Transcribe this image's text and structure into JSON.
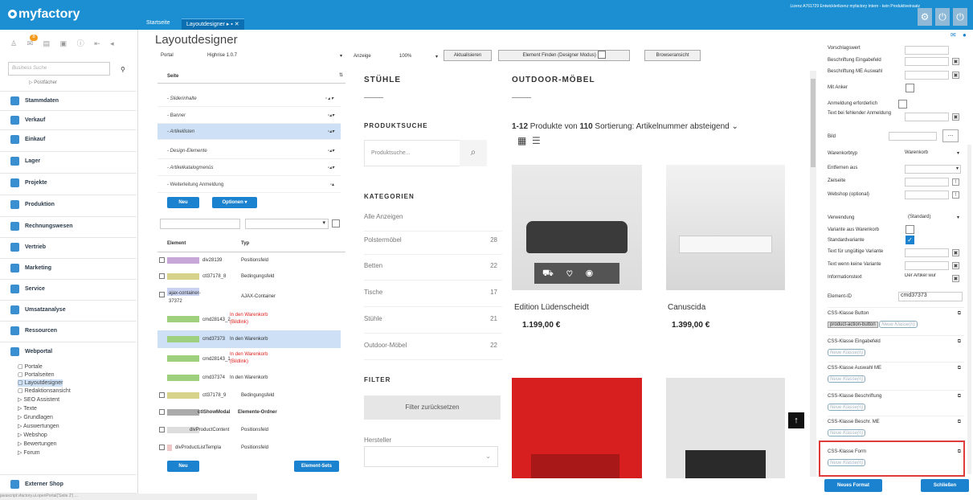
{
  "app": {
    "logo": "myfactory",
    "tabs": [
      {
        "label": "Startseite"
      },
      {
        "label": "Layoutdesigner"
      }
    ],
    "license": "Lizenz A761729 Entwicklerlizenz myfactory Intern - kein Produktiveinsatz",
    "badge_count": "8"
  },
  "sidebar": {
    "search_placeholder": "Business Suche",
    "truncated_item": "▷ Postfächer",
    "items": [
      {
        "label": "Stammdaten"
      },
      {
        "label": "Verkauf"
      },
      {
        "label": "Einkauf"
      },
      {
        "label": "Lager"
      },
      {
        "label": "Projekte"
      },
      {
        "label": "Produktion"
      },
      {
        "label": "Rechnungswesen"
      },
      {
        "label": "Vertrieb"
      },
      {
        "label": "Marketing"
      },
      {
        "label": "Service"
      },
      {
        "label": "Umsatzanalyse"
      },
      {
        "label": "Ressourcen"
      },
      {
        "label": "Webportal"
      }
    ],
    "sub": [
      "Portale",
      "Portalseiten",
      "Layoutdesigner",
      "Redaktionsansicht",
      "▷ SEO Assistent",
      "▷ Texte",
      "▷ Grundlagen",
      "▷ Auswertungen",
      "▷ Webshop",
      "▷ Bewertungen",
      "▷ Forum"
    ],
    "external": "Externer Shop"
  },
  "designer": {
    "title": "Layoutdesigner",
    "portal_label": "Portal",
    "portal_value": "Highrise 1.0.7",
    "view_label": "Anzeige",
    "zoom": "100%",
    "refresh": "Aktualisieren",
    "find": "Element Finden (Designer Modus)",
    "browser": "Browseransicht",
    "page_col": "Seite",
    "pages": [
      "- Sliderinhalte",
      "- Banner",
      "- Artikellisten",
      "- Design-Elemente",
      "- Artikelkatalogmenüs",
      "- Weiterleitung Anmeldung"
    ],
    "new_btn": "Neu",
    "options_btn": "Optionen ▾",
    "el_col": "Element",
    "type_col": "Typ",
    "elements": [
      {
        "el": "div28139",
        "type": "Positionsfeld"
      },
      {
        "el": "ctl37178_8",
        "type": "Bedingungsfeld"
      },
      {
        "el": "ajax-container-37372",
        "type": "AJAX-Container"
      },
      {
        "el": "cmd28143_2",
        "type": "In den Warenkorb (Bildlink)"
      },
      {
        "el": "cmd37373",
        "type": "In den Warenkorb"
      },
      {
        "el": "cmd28143_1",
        "type": "In den Warenkorb (Bildlink)"
      },
      {
        "el": "cmd37374",
        "type": "In den Warenkorb"
      },
      {
        "el": "ctl37178_9",
        "type": "Bedingungsfeld"
      },
      {
        "el": "ctlShowModal",
        "type": "Elemente-Ordner"
      },
      {
        "el": "divProductContent",
        "type": "Positionsfeld"
      },
      {
        "el": "divProductListTempla",
        "type": "Positionsfeld"
      }
    ],
    "new_btn2": "Neu",
    "sets_btn": "Element-Sets"
  },
  "preview": {
    "stuehle": "STÜHLE",
    "outdoor": "OUTDOOR-MÖBEL",
    "search_title": "PRODUKTSUCHE",
    "search_ph": "Produktsuche...",
    "cat_title": "KATEGORIEN",
    "cats": [
      {
        "name": "Alle Anzeigen",
        "n": ""
      },
      {
        "name": "Polstermöbel",
        "n": "28"
      },
      {
        "name": "Betten",
        "n": "22"
      },
      {
        "name": "Tische",
        "n": "17"
      },
      {
        "name": "Stühle",
        "n": "21"
      },
      {
        "name": "Outdoor-Möbel",
        "n": "22"
      }
    ],
    "filter_title": "FILTER",
    "filter_reset": "Filter zurücksetzen",
    "manufacturer": "Hersteller",
    "count_prefix": "1-12",
    "count_mid": " Produkte von ",
    "count_total": "110",
    "sort": "Sortierung: Artikelnummer absteigend",
    "products": [
      {
        "name": "Edition Lüdenscheidt",
        "price": "1.199,00",
        "cur": "€"
      },
      {
        "name": "Canuscida",
        "price": "1.399,00",
        "cur": "€"
      }
    ]
  },
  "props": {
    "r1": "Vorschlagswert",
    "r2": "Beschriftung Eingabefeld",
    "r3": "Beschriftung ME Auswahl",
    "r4": "Mit Anker",
    "r5": "Anmeldung erforderlich",
    "r6": "Text bei fehlender Anmeldung",
    "r7": "Bild",
    "r8": "Warenkorbtyp",
    "r8v": "Warenkorb",
    "r9": "Entfernen aus",
    "r10": "Zielseite",
    "r11": "Webshop (optional)",
    "r12": "Verwendung",
    "r12v": "(Standard)",
    "r13": "Variante aus Warenkorb",
    "r14": "Standardvariante",
    "r15": "Text für ungültige Variante",
    "r16": "Text wenn keine Variante",
    "r17": "Informationstext",
    "r17v": "Der Artikel wur",
    "r18": "Element-ID",
    "r18v": "cmd37373",
    "css": [
      {
        "label": "CSS-Klasse Button",
        "val": "product-action-button"
      },
      {
        "label": "CSS-Klasse Eingabefeld"
      },
      {
        "label": "CSS-Klasse Auswahl ME"
      },
      {
        "label": "CSS-Klasse Beschriftung"
      },
      {
        "label": "CSS-Klasse Beschr. ME"
      },
      {
        "label": "CSS-Klasse Form"
      }
    ],
    "new_class": "Neue Klasse(n)",
    "new_format": "Neues Format",
    "close": "Schließen"
  },
  "statusbar": "javascript:vfactory.ui.openPortal('Seite 2') ..."
}
